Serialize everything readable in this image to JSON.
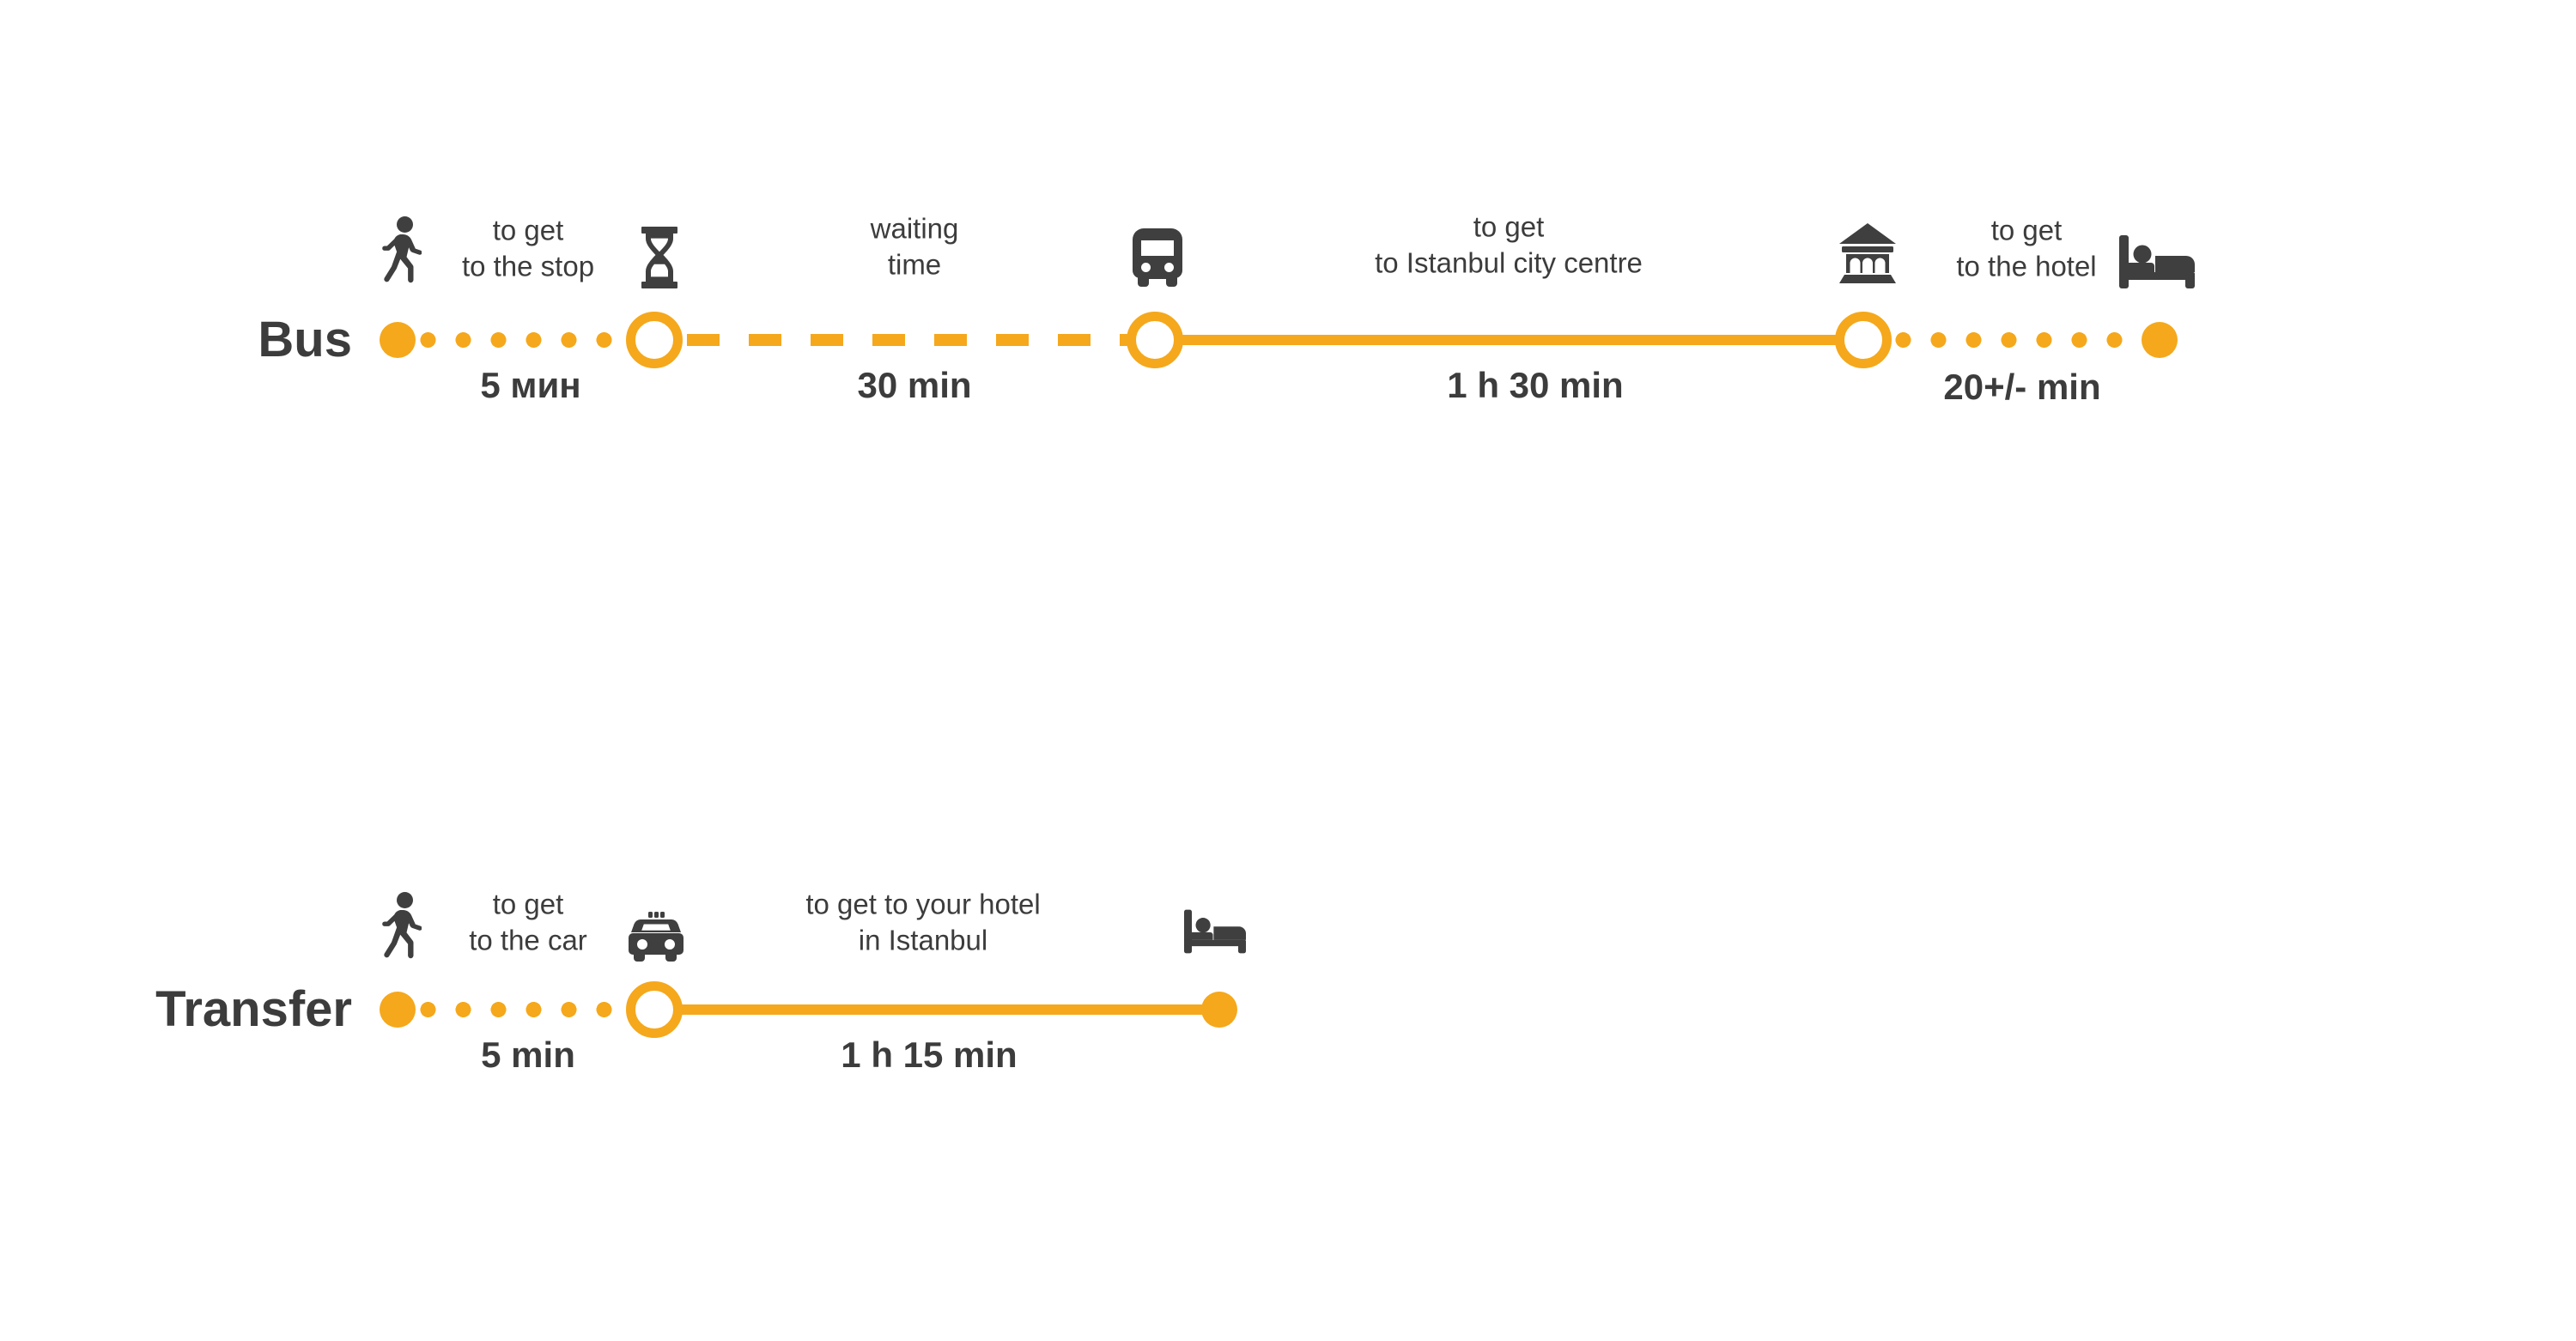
{
  "colors": {
    "accent": "#f5a81c",
    "ink": "#3c3c3c",
    "background": "#ffffff"
  },
  "chart_data": {
    "type": "timeline",
    "title": "",
    "rows": [
      {
        "label": "Bus",
        "total_segments": 4,
        "segments": [
          {
            "caption": "to get\nto the stop",
            "duration": "5 мин",
            "style": "dotted",
            "start_icon": "walking-person-icon",
            "end_icon": "hourglass-icon"
          },
          {
            "caption": "waiting\ntime",
            "duration": "30 min",
            "style": "dashed",
            "start_icon": "hourglass-icon",
            "end_icon": "bus-icon"
          },
          {
            "caption": "to get\nto Istanbul city centre",
            "duration": "1 h 30 min",
            "style": "solid",
            "start_icon": "bus-icon",
            "end_icon": "bank-icon"
          },
          {
            "caption": "to get\nto the hotel",
            "duration": "20+/- min",
            "style": "dotted",
            "start_icon": "bank-icon",
            "end_icon": "bed-icon"
          }
        ]
      },
      {
        "label": "Transfer",
        "total_segments": 2,
        "segments": [
          {
            "caption": "to get\nto the car",
            "duration": "5 min",
            "style": "dotted",
            "start_icon": "walking-person-icon",
            "end_icon": "taxi-icon"
          },
          {
            "caption": "to get to your hotel\nin Istanbul",
            "duration": "1 h 15 min",
            "style": "solid",
            "start_icon": "taxi-icon",
            "end_icon": "bed-icon"
          }
        ]
      }
    ]
  },
  "bus_row": {
    "label": "Bus",
    "seg1": {
      "caption": "to get\nto the stop",
      "duration": "5 мин"
    },
    "seg2": {
      "caption": "waiting\ntime",
      "duration": "30 min"
    },
    "seg3": {
      "caption": "to get\nto Istanbul city centre",
      "duration": "1 h 30 min"
    },
    "seg4": {
      "caption": "to get\nto the hotel",
      "duration": "20+/- min"
    }
  },
  "transfer_row": {
    "label": "Transfer",
    "seg1": {
      "caption": "to get\nto the car",
      "duration": "5 min"
    },
    "seg2": {
      "caption": "to get to your hotel\nin Istanbul",
      "duration": "1 h 15 min"
    }
  },
  "icons": {
    "walking": "walking-person-icon",
    "hourglass": "hourglass-icon",
    "bus": "bus-icon",
    "bank": "bank-icon",
    "bed": "bed-icon",
    "taxi": "taxi-icon"
  }
}
